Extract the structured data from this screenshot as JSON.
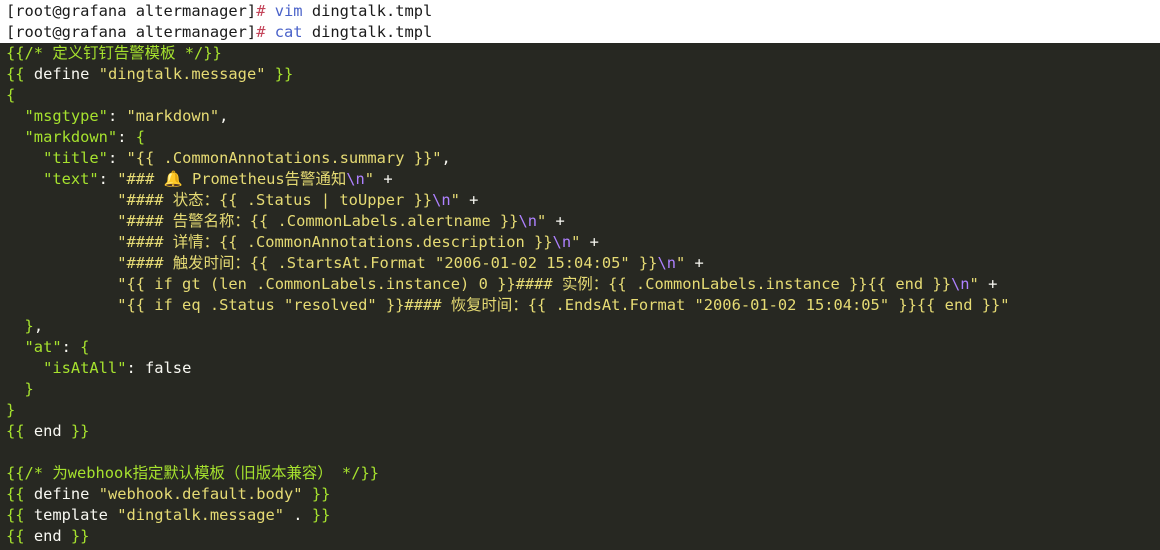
{
  "window": {
    "title": "root@grafana altermanager"
  },
  "prompt_lines": [
    {
      "prompt": "[root@grafana altermanager]",
      "hash": "#",
      "command": "vim",
      "argument": "dingtalk.tmpl"
    },
    {
      "prompt": "[root@grafana altermanager]",
      "hash": "#",
      "command": "cat",
      "argument": "dingtalk.tmpl"
    }
  ],
  "code": [
    [
      [
        "g",
        "{{/* 定义钉钉告警模板 */}}"
      ]
    ],
    [
      [
        "g",
        "{{ "
      ],
      [
        "w",
        "define "
      ],
      [
        "y",
        "\"dingtalk.message\""
      ],
      [
        "g",
        " }}"
      ]
    ],
    [
      [
        "g",
        "{"
      ]
    ],
    [
      [
        "g",
        "  \"msgtype\""
      ],
      [
        "w",
        ": "
      ],
      [
        "y",
        "\"markdown\""
      ],
      [
        "w",
        ","
      ]
    ],
    [
      [
        "g",
        "  \"markdown\""
      ],
      [
        "w",
        ": "
      ],
      [
        "g",
        "{"
      ]
    ],
    [
      [
        "g",
        "    \"title\""
      ],
      [
        "w",
        ": "
      ],
      [
        "y",
        "\"{{ .CommonAnnotations.summary }}\""
      ],
      [
        "w",
        ","
      ]
    ],
    [
      [
        "g",
        "    \"text\""
      ],
      [
        "w",
        ": "
      ],
      [
        "y",
        "\"### "
      ],
      [
        "bell",
        "🔔"
      ],
      [
        "y",
        " Prometheus告警通知"
      ],
      [
        "p",
        "\\n"
      ],
      [
        "y",
        "\""
      ],
      [
        "w",
        " +"
      ]
    ],
    [
      [
        "y",
        "            \"#### 状态：{{ .Status | toUpper }}"
      ],
      [
        "p",
        "\\n"
      ],
      [
        "y",
        "\""
      ],
      [
        "w",
        " +"
      ]
    ],
    [
      [
        "y",
        "            \"#### 告警名称：{{ .CommonLabels.alertname }}"
      ],
      [
        "p",
        "\\n"
      ],
      [
        "y",
        "\""
      ],
      [
        "w",
        " +"
      ]
    ],
    [
      [
        "y",
        "            \"#### 详情：{{ .CommonAnnotations.description }}"
      ],
      [
        "p",
        "\\n"
      ],
      [
        "y",
        "\""
      ],
      [
        "w",
        " +"
      ]
    ],
    [
      [
        "y",
        "            \"#### 触发时间：{{ .StartsAt.Format \"2006-01-02 15:04:05\" }}"
      ],
      [
        "p",
        "\\n"
      ],
      [
        "y",
        "\""
      ],
      [
        "w",
        " +"
      ]
    ],
    [
      [
        "y",
        "            \"{{ if gt (len .CommonLabels.instance) 0 }}#### 实例：{{ .CommonLabels.instance }}{{ end }}"
      ],
      [
        "p",
        "\\n"
      ],
      [
        "y",
        "\""
      ],
      [
        "w",
        " +"
      ]
    ],
    [
      [
        "y",
        "            \"{{ if eq .Status \"resolved\" }}#### 恢复时间：{{ .EndsAt.Format \"2006-01-02 15:04:05\" }}{{ end }}\""
      ]
    ],
    [
      [
        "g",
        "  }"
      ],
      [
        "w",
        ","
      ]
    ],
    [
      [
        "g",
        "  \"at\""
      ],
      [
        "w",
        ": "
      ],
      [
        "g",
        "{"
      ]
    ],
    [
      [
        "g",
        "    \"isAtAll\""
      ],
      [
        "w",
        ": false"
      ]
    ],
    [
      [
        "g",
        "  }"
      ]
    ],
    [
      [
        "g",
        "}"
      ]
    ],
    [
      [
        "g",
        "{{ "
      ],
      [
        "w",
        "end"
      ],
      [
        "g",
        " }}"
      ]
    ],
    [
      [
        "w",
        ""
      ]
    ],
    [
      [
        "g",
        "{{/* 为webhook指定默认模板（旧版本兼容） */}}"
      ]
    ],
    [
      [
        "g",
        "{{ "
      ],
      [
        "w",
        "define "
      ],
      [
        "y",
        "\"webhook.default.body\""
      ],
      [
        "g",
        " }}"
      ]
    ],
    [
      [
        "g",
        "{{ "
      ],
      [
        "w",
        "template "
      ],
      [
        "y",
        "\"dingtalk.message\""
      ],
      [
        "w",
        " . "
      ],
      [
        "g",
        "}}"
      ]
    ],
    [
      [
        "g",
        "{{ "
      ],
      [
        "w",
        "end"
      ],
      [
        "g",
        " }}"
      ]
    ]
  ],
  "colors": {
    "code_background": "#272822",
    "prompt_background": "#ffffff",
    "green": "#a6e22e",
    "yellow": "#e6db74",
    "purple": "#ae81ff",
    "white": "#f8f8f2",
    "command_blue": "#4a62c9",
    "hash_red": "#c4455a"
  },
  "icons": [
    "bell-icon"
  ]
}
